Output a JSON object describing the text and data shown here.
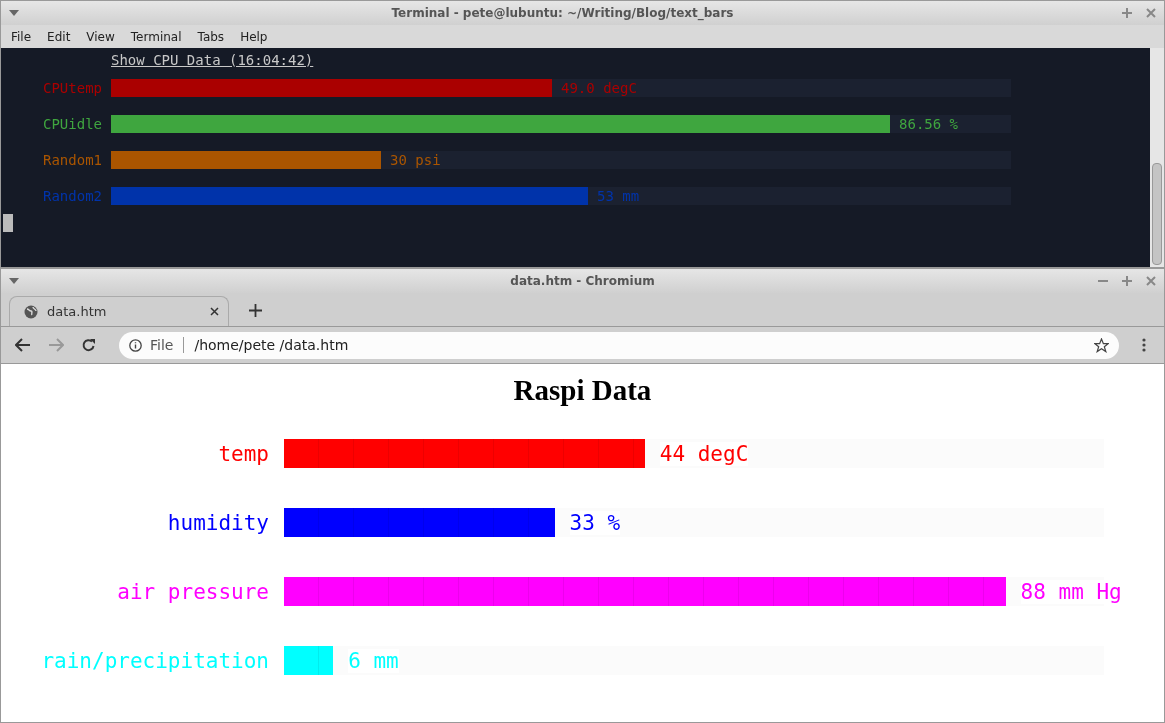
{
  "terminal": {
    "title": "Terminal - pete@lubuntu: ~/Writing/Blog/text_bars",
    "menu": [
      "File",
      "Edit",
      "View",
      "Terminal",
      "Tabs",
      "Help"
    ],
    "heading": "Show CPU Data (16:04:42)",
    "bars": [
      {
        "name": "CPUtemp",
        "level": 0.49,
        "reading": "49.0 degC",
        "color": "#aa0000"
      },
      {
        "name": "CPUidle",
        "level": 0.8656,
        "reading": "86.56 %",
        "color": "#3fa63f"
      },
      {
        "name": "Random1",
        "level": 0.3,
        "reading": "30 psi",
        "color": "#aa5500"
      },
      {
        "name": "Random2",
        "level": 0.53,
        "reading": "53 mm",
        "color": "#0033aa"
      }
    ]
  },
  "browser": {
    "title": "data.htm - Chromium",
    "tabs": [
      {
        "label": "data.htm",
        "selected": true
      }
    ],
    "address": {
      "scheme": "File",
      "url": "/home/pete /data.htm"
    },
    "page": {
      "title": "Raspi Data",
      "bars": [
        {
          "name": "temp",
          "level": 0.44,
          "reading": "44 degC",
          "color": "#ff0000"
        },
        {
          "name": "humidity",
          "level": 0.33,
          "reading": "33 %",
          "color": "#0000ff"
        },
        {
          "name": "air pressure",
          "level": 0.88,
          "reading": "88 mm Hg",
          "color": "#ff00ff"
        },
        {
          "name": "rain/precipitation",
          "level": 0.06,
          "reading": "6 mm",
          "color": "#00ffff"
        }
      ]
    }
  }
}
